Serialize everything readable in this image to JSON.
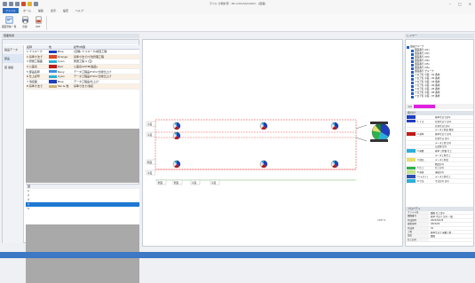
{
  "window": {
    "title": "ラベル 分類計算 - NC-CAD/AS/CAD/2 - [図面]"
  },
  "quick_access": [
    "save-icon",
    "undo-icon",
    "redo-icon",
    "print-icon",
    "open-icon",
    "settings-icon"
  ],
  "ribbon": {
    "tabs": [
      {
        "label": "ファイル",
        "active": true
      },
      {
        "label": "ホーム",
        "active": false
      },
      {
        "label": "編集",
        "active": false
      },
      {
        "label": "表示",
        "active": false
      },
      {
        "label": "設定",
        "active": false
      },
      {
        "label": "ヘルプ",
        "active": false
      }
    ],
    "buttons": [
      {
        "label": "図面登録/一覧",
        "icon": "drawing-register-icon"
      },
      {
        "label": "印刷",
        "icon": "print-icon"
      },
      {
        "label": "PDF",
        "icon": "pdf-icon"
      }
    ],
    "group_label": "図面"
  },
  "left_panel": {
    "title": "図面情報",
    "nav": [
      {
        "label": "製品データ",
        "selected": false
      },
      {
        "label": "部品",
        "selected": true
      },
      {
        "label": "図 番組",
        "selected": false
      }
    ],
    "table": {
      "headers": [
        "名称",
        "色",
        "記号/内容"
      ],
      "rows": [
        {
          "name": "1 ナスマーク",
          "color": "#1f3fbf",
          "cname": "Blue",
          "desc": "(空欄) ナスマーク/検査工程"
        },
        {
          "name": "2 基準寸法で",
          "color": "#d94a2a",
          "cname": "Orange",
          "desc": "基準寸法で/寸法管理工程"
        },
        {
          "name": "3 研磨工程面",
          "color": "#2ab0d8",
          "cname": "Cyan",
          "desc": "研磨工程 A (空)"
        },
        {
          "name": "4 公差表",
          "color": "#c01a1a",
          "cname": "Red",
          "desc": "公差表/ASTM(製品)"
        },
        {
          "name": "5 部品名称",
          "color": "#3c8de0",
          "cname": "Navy",
          "desc": "データ工程品/Fdml 仕様仕上げ"
        },
        {
          "name": "6 仕上記号",
          "color": "#2ab0d8",
          "cname": "Cyan",
          "desc": "データ工程品/Fdml 仕様仕上げ"
        },
        {
          "name": "7 溶接面",
          "color": "#1f3fbf",
          "cname": "Blue",
          "desc": "データ工程品/仕上げ"
        },
        {
          "name": "8 基準寸法で",
          "color": "#cbb27a",
          "cname": "Tan & 他",
          "desc": "基準寸法で/溶接"
        }
      ]
    },
    "list": {
      "header": "図",
      "items": [
        {
          "label": "1",
          "selected": false
        },
        {
          "label": "2",
          "selected": false
        },
        {
          "label": "3",
          "selected": false
        },
        {
          "label": "4",
          "selected": true
        },
        {
          "label": "5",
          "selected": false
        }
      ]
    }
  },
  "canvas": {
    "node_labels": [
      "平面",
      "平面",
      "断面",
      "平面",
      "断面",
      "断面",
      "平面",
      "平面"
    ],
    "zoom": "100 %",
    "legend_label": "凡例"
  },
  "right_panel": {
    "title": "レイヤー",
    "tree": [
      {
        "label": "図面グループ",
        "root": true
      },
      {
        "label": "図面番号 (01)",
        "root": false
      },
      {
        "label": "図面番号 (02)",
        "root": false
      },
      {
        "label": "図面番号 (03)",
        "root": false
      },
      {
        "label": "図面番号 (04)",
        "root": false
      },
      {
        "label": "図面番号 (05)",
        "root": false
      },
      {
        "label": "図面番号 (06)",
        "root": false
      },
      {
        "label": "図面番号 グループ",
        "root": false
      },
      {
        "label": "フロア名 平面 - 01 番地",
        "root": false
      },
      {
        "label": "フロア名 平面 - 02 番地",
        "root": false
      },
      {
        "label": "フロア名 平面 - 03 番地",
        "root": false
      },
      {
        "label": "フロア名 平面 - 04 番地",
        "root": false
      },
      {
        "label": "フロア名 平面 - 05 番地",
        "root": false
      },
      {
        "label": "フロア名 平面 - 06 番地",
        "root": false
      },
      {
        "label": "フロア名 平面 - 07 番地",
        "root": false
      }
    ],
    "swatch_label": "凡例",
    "props_title": "色分け",
    "props": [
      {
        "color": "#1f3fbf",
        "key": "",
        "val": "基準寸法で記号"
      },
      {
        "color": "#1f3fbf",
        "key": "1 ナス",
        "val": "仕様寸法で 記号"
      },
      {
        "color": "",
        "key": "",
        "val": "仕様寸法/ 記号"
      },
      {
        "color": "",
        "key": "",
        "val": "データ工程品 精度"
      },
      {
        "color": "#c01a1a",
        "key": "2 基準",
        "val": "基準寸法で 記号"
      },
      {
        "color": "",
        "key": "",
        "val": "仕様寸法 記号"
      },
      {
        "color": "",
        "key": "",
        "val": "データ工程 記号"
      },
      {
        "color": "",
        "key": "",
        "val": "公差値 記号"
      },
      {
        "color": "#2ab0d8",
        "key": "3 研磨",
        "val": "基準 工程面 仕上"
      },
      {
        "color": "",
        "key": "",
        "val": "データ工程仕上"
      },
      {
        "color": "#e5e06a",
        "key": "4 部品",
        "val": "データ工程品"
      },
      {
        "color": "",
        "key": "",
        "val": "精度記号"
      },
      {
        "color": "#2fb24a",
        "key": "5 仕上",
        "val": "仕上記号"
      },
      {
        "color": "#c3e08a",
        "key": "6 溶接",
        "val": "溶接記号"
      },
      {
        "color": "#2f4fb0",
        "key": "7 (テスト)",
        "val": "データ工程仕上"
      },
      {
        "color": "#2ab0d8",
        "key": "8 寸法",
        "val": "寸法記号 記号"
      }
    ],
    "details_title": "プロパティ",
    "details": [
      {
        "key": "ファイル名",
        "val": "図面 仕上記号"
      },
      {
        "key": "図面番号",
        "val": "基準 寸法で 記号 一覧"
      },
      {
        "key": "作成日時",
        "val": "2021/01/26"
      },
      {
        "key": "更新日時",
        "val": "2021/02"
      },
      {
        "key": "作成者",
        "val": "01"
      },
      {
        "key": "工程",
        "val": "基準寸法で 研磨工程"
      },
      {
        "key": "部品",
        "val": "図面"
      },
      {
        "key": "仕上記号",
        "val": ""
      }
    ]
  },
  "colors": {
    "accent": "#2b6cc4",
    "selection": "#1e78d2",
    "statusbar": "#3c78c4"
  }
}
